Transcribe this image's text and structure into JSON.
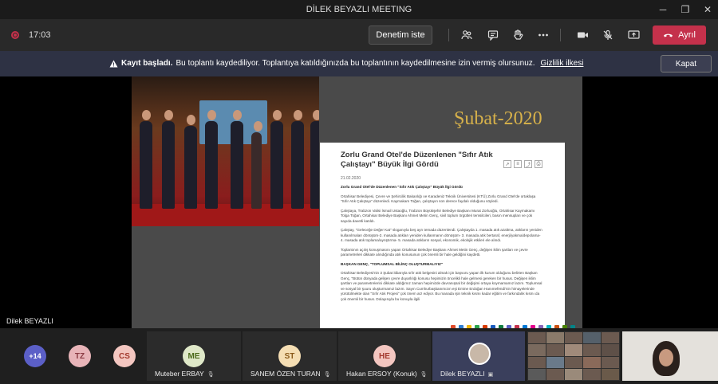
{
  "window": {
    "title": "DİLEK BEYAZLI MEETING",
    "minimize": "─",
    "maximize": "❐",
    "close": "✕"
  },
  "toolbar": {
    "elapsed": "17:03",
    "present_label": "Denetim iste",
    "leave_label": "Ayrıl"
  },
  "banner": {
    "bold": "Kayıt başladı.",
    "text": "Bu toplantı kaydediliyor. Toplantıya katıldığınızda bu toplantının kaydedilmesine izin vermiş olursunuz.",
    "link": "Gizlilik ilkesi",
    "close_label": "Kapat"
  },
  "slide": {
    "date": "Şubat-2020",
    "doc": {
      "title": "Zorlu Grand Otel'de Düzenlenen \"Sıfır Atık Çalıştayı\" Büyük İlgi Gördü",
      "date": "21.02.2020",
      "heading1": "Zorlu Grand Otel'de Düzenlenen \"Sıfır Atık Çalıştayı\" Büyük İlgi Gördü",
      "p1": "Ortahisar Belediyesi, Çevre ve Şehircilik Bakanlığı ve Karadeniz Teknik Üniversitesi (KTÜ) Zorlu Grand Otel'de ortaklaşa \"Sıfır Atık Çalıştayı\" düzenledi. Kaymakam Toğan, çalıştayın son derece faydalı olduğunu söyledi.",
      "p2": "Çalıştaya, Trabzon Valisi İsmail Ustaoğlu, Trabzon Büyükşehir Belediye Başkanı Murat Zorluoğlu, Ortahisar Kaymakamı Tolga Toğan, Ortahisar Belediye Başkanı Ahmet Metin Genç, sivil toplum örgütleri temsilcileri, basın mensupları ve çok sayıda davetli katıldı.",
      "p3": "Çalıştay, \"Geleceğe Değer Kat\" sloganıyla beş ayrı temada düzenlendi. Çalıştayda 1. masada atık azaltma, atıkların yeniden kullanılmaları dönüşüm-2. masada atıkları yeniden kullanmanın dönüşüm- 3. masada atık bertaraf, enerji/yakma/depolama- 4. masada atık toplama/ayrıştırma- 5. masada atıkların sosyal, ekonomik, ekolojik etkileri ele alındı.",
      "p4": "Toplantının açılış konuşmasını yapan Ortahisar Belediye Başkanı Ahmet Metin Genç, değişen iklim şartları ve çevre parametreleri dikkate alındığında atık konusunun çok önemli bir hale geldiğini kaydetti.",
      "heading2": "BAŞKAN GENÇ, \"TOPLUMSAL BİLİNÇ OLUŞTURMALIYIZ\"",
      "p5": "Ortahisar Belediyesi'nin 3 Şubat itibarıyla sıfır atık belgesini almak için başvuru yapan ilk kurum olduğunu belirten Başkan Genç, \"Bütün dünyada gelişen çevre duyarlılığı konusu hepimizin öncelikli hale gelmesi gereken bir husus. Değişen iklim şartları ve parametrelerini dikkate aldığımız zaman hepimizde davranışsal bir değişimi ortaya koymamamız lazım. Toplumsal ve sosyal bir şuuru oluşturmamız lazım. Sayın Cumhurbaşkanımızın eşi Emine Erdoğan Hanımefendi'nin himayelerinde yürütülmekte olan \"Sıfır Atık Projesi\" çok önem arz ediyor. Bu manada işin teknik kısmı kadar eğitim ve farkındalık kısmı da çok önemli bir husus. Dolayısıyla bu konuyla ilgili"
    }
  },
  "stage": {
    "speaker": "Dilek BEYAZLI"
  },
  "participants": {
    "overflow": "+14",
    "avatars": [
      {
        "initials": "TZ",
        "bg": "#e8b4b8",
        "fg": "#8a3a42"
      },
      {
        "initials": "CS",
        "bg": "#f3c6c0",
        "fg": "#a33a2e"
      }
    ],
    "tiles": [
      {
        "initials": "ME",
        "name": "Muteber ERBAY",
        "bg": "#dfe8c8",
        "fg": "#4b6a1a"
      },
      {
        "initials": "ST",
        "name": "SANEM ÖZEN TURAN",
        "bg": "#f5deb3",
        "fg": "#8a5a1a"
      },
      {
        "initials": "HE",
        "name": "Hakan ERSOY (Konuk)",
        "bg": "#f3c6c0",
        "fg": "#a33a2e"
      }
    ],
    "presenter": {
      "name": "Dilek BEYAZLI"
    }
  },
  "colors": {
    "leave": "#c4314b",
    "banner_bg": "#2e3244",
    "slide_date": "#d8b24a",
    "overflow_bg": "#5b5fc7"
  },
  "icons": {
    "people": "people-icon",
    "chat": "chat-icon",
    "raise_hand": "raise-hand-icon",
    "more": "more-icon",
    "camera": "camera-icon",
    "mic": "mic-off-icon",
    "share": "share-tray-icon",
    "phone": "phone-icon"
  }
}
